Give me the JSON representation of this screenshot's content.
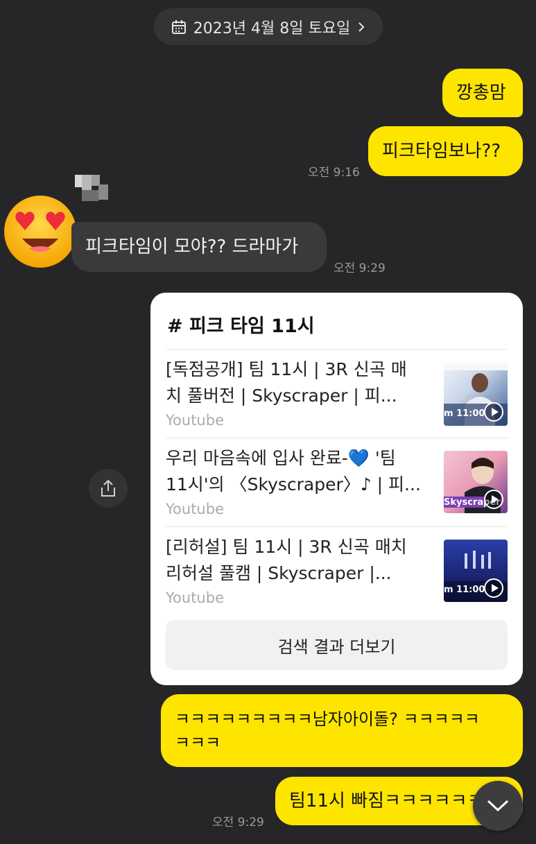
{
  "date_divider": {
    "label": "2023년 4월 8일 토요일",
    "icon": "calendar-icon",
    "chevron": "chevron-right-icon"
  },
  "messages": {
    "out1": "깡총맘",
    "out2": "피크타임보나??",
    "out2_time": "오전 9:16",
    "in1": "피크타임이 모야?? 드라마가",
    "in1_time": "오전 9:29",
    "out3": "ㅋㅋㅋㅋㅋㅋㅋㅋㅋ남자아이돌? ㅋㅋㅋㅋㅋ\nㅋㅋㅋ",
    "out4": "팀11시 빠짐ㅋㅋㅋㅋㅋㅋ",
    "out4_time": "오전 9:29"
  },
  "search_card": {
    "title": "# 피크 타임 11시",
    "results": [
      {
        "title": "[독점공개] 팀 11시 | 3R 신곡 매\n치 풀버전 | Skyscraper | 피...",
        "source": "Youtube",
        "thumb_caption": "m 11:00"
      },
      {
        "title": "우리 마음속에 입사 완료-💙 '팀\n 11시'의 〈Skyscraper〉♪ | 피...",
        "source": "Youtube",
        "thumb_caption": "Skyscraper"
      },
      {
        "title": "[리허설] 팀 11시 | 3R 신곡 매치\n리허설 풀캠 | Skyscraper |...",
        "source": "Youtube",
        "thumb_caption": "m 11:00"
      }
    ],
    "more_button": "검색 결과 더보기"
  },
  "colors": {
    "background": "#262628",
    "my_bubble": "#fee500",
    "their_bubble": "#3a3a3c"
  },
  "icons": {
    "share": "share-icon",
    "scroll_down": "chevron-down-icon",
    "avatar": "heart-eyes-emoji-avatar"
  }
}
